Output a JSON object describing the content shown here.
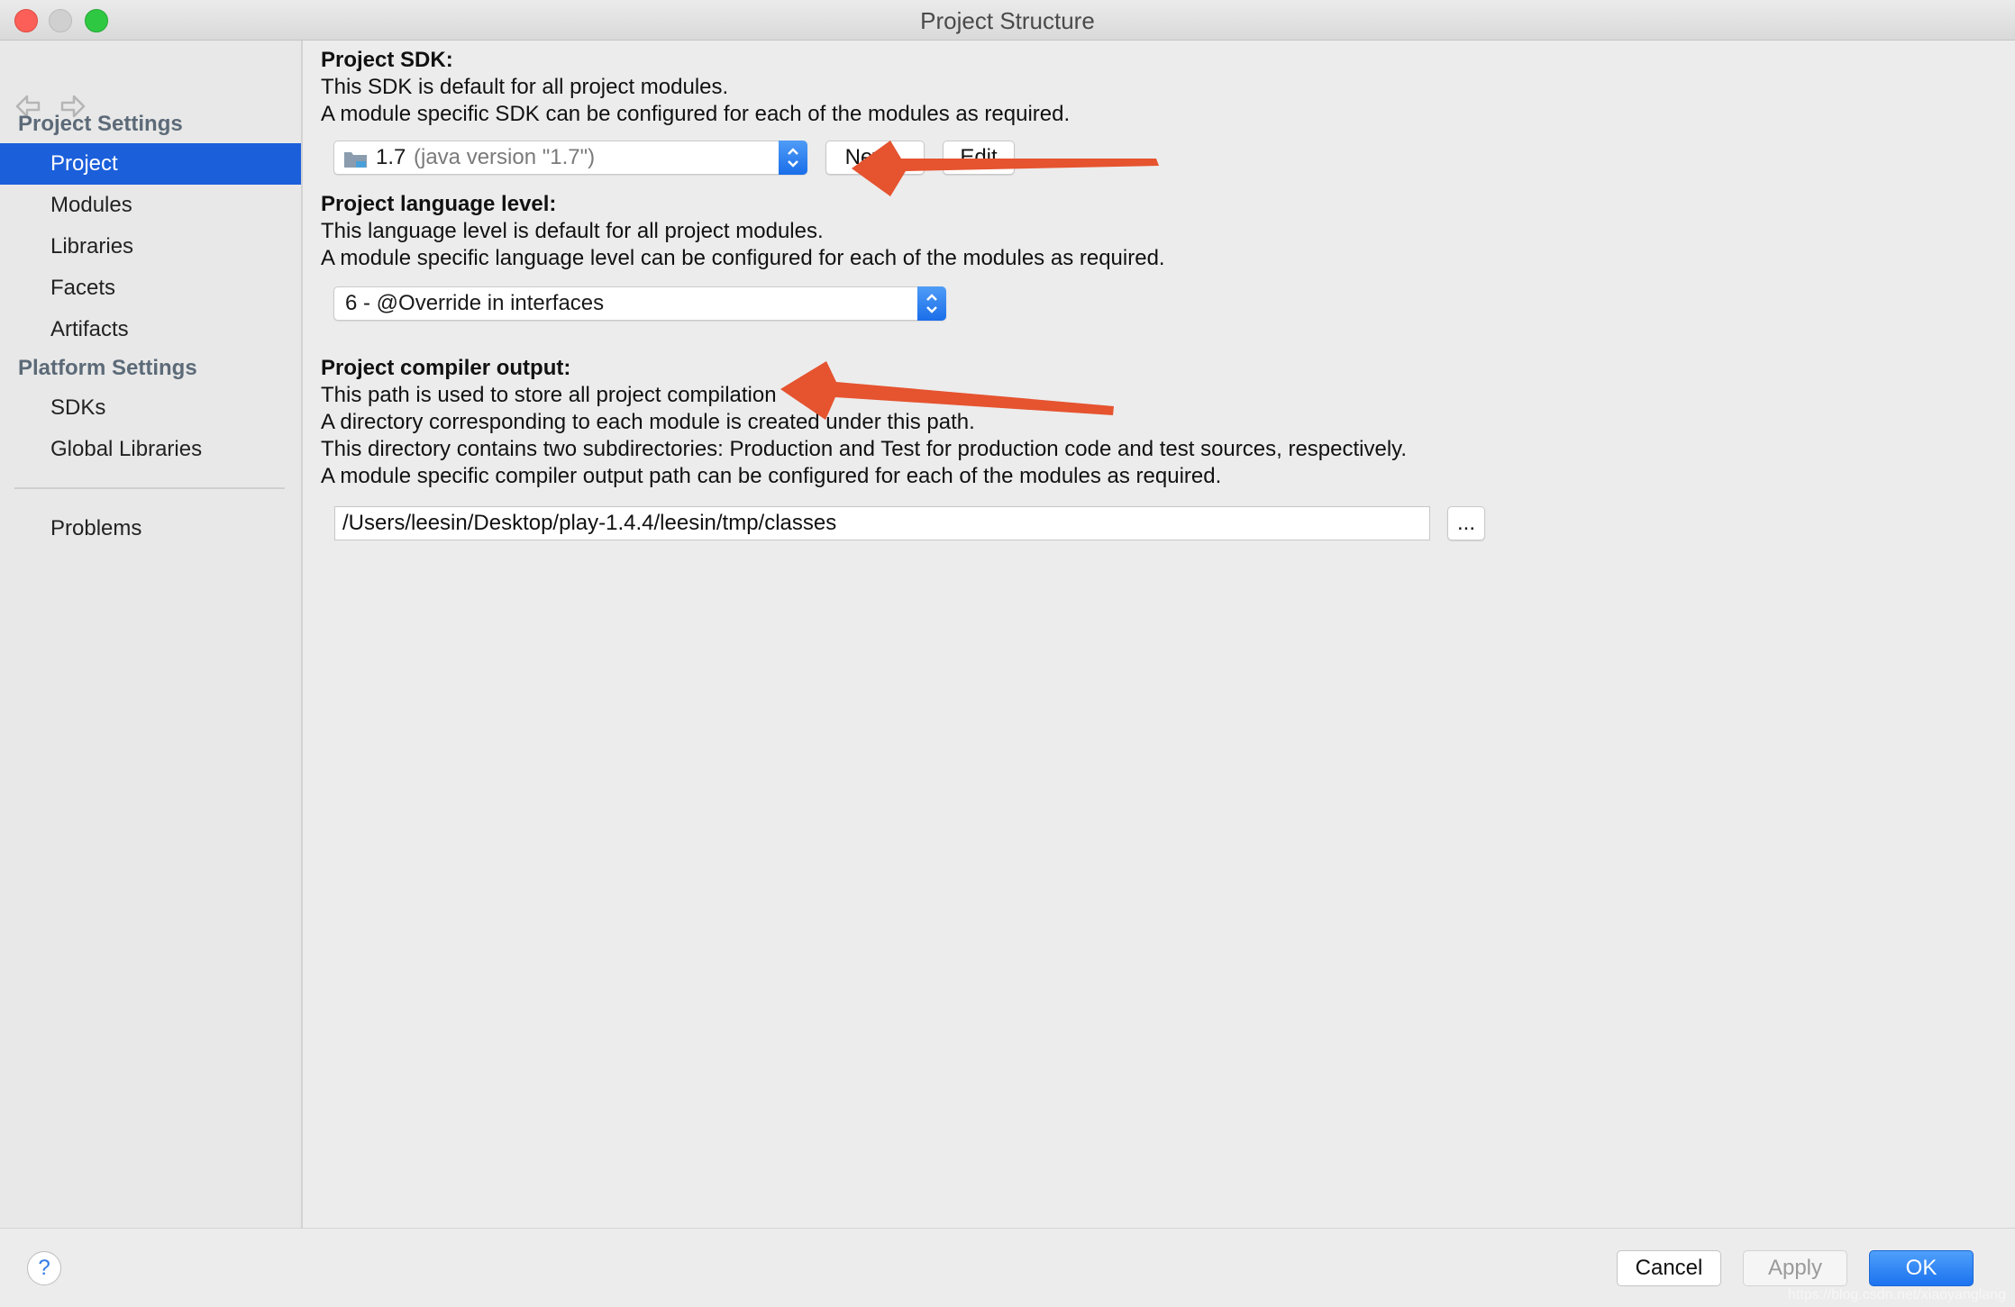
{
  "window": {
    "title": "Project Structure"
  },
  "sidebar": {
    "project_settings_label": "Project Settings",
    "platform_settings_label": "Platform Settings",
    "items": [
      {
        "label": "Project",
        "selected": true
      },
      {
        "label": "Modules"
      },
      {
        "label": "Libraries"
      },
      {
        "label": "Facets"
      },
      {
        "label": "Artifacts"
      },
      {
        "label": "SDKs"
      },
      {
        "label": "Global Libraries"
      },
      {
        "label": "Problems"
      }
    ]
  },
  "sdk": {
    "heading": "Project SDK:",
    "line1": "This SDK is default for all project modules.",
    "line2": "A module specific SDK can be configured for each of the modules as required.",
    "selected_version": "1.7",
    "selected_detail": "(java version \"1.7\")",
    "new_button": "New...",
    "edit_button": "Edit"
  },
  "language_level": {
    "heading": "Project language level:",
    "line1": "This language level is default for all project modules.",
    "line2": "A module specific language level can be configured for each of the modules as required.",
    "selected": "6 - @Override in interfaces"
  },
  "compiler_output": {
    "heading": "Project compiler output:",
    "line1": "This path is used to store all project compilation",
    "line2": "A directory corresponding to each module is created under this path.",
    "line3": "This directory contains two subdirectories: Production and Test for production code and test sources, respectively.",
    "line4": "A module specific compiler output path can be configured for each of the modules as required.",
    "path_value": "/Users/leesin/Desktop/play-1.4.4/leesin/tmp/classes",
    "browse_button": "..."
  },
  "footer": {
    "help": "?",
    "cancel": "Cancel",
    "apply": "Apply",
    "ok": "OK"
  },
  "watermark": "https://blog.csdn.net/xiaoyanglang",
  "colors": {
    "selection": "#1b5fdb",
    "annotation_arrow": "#e5532f",
    "ok_button": "#1c72ee"
  }
}
